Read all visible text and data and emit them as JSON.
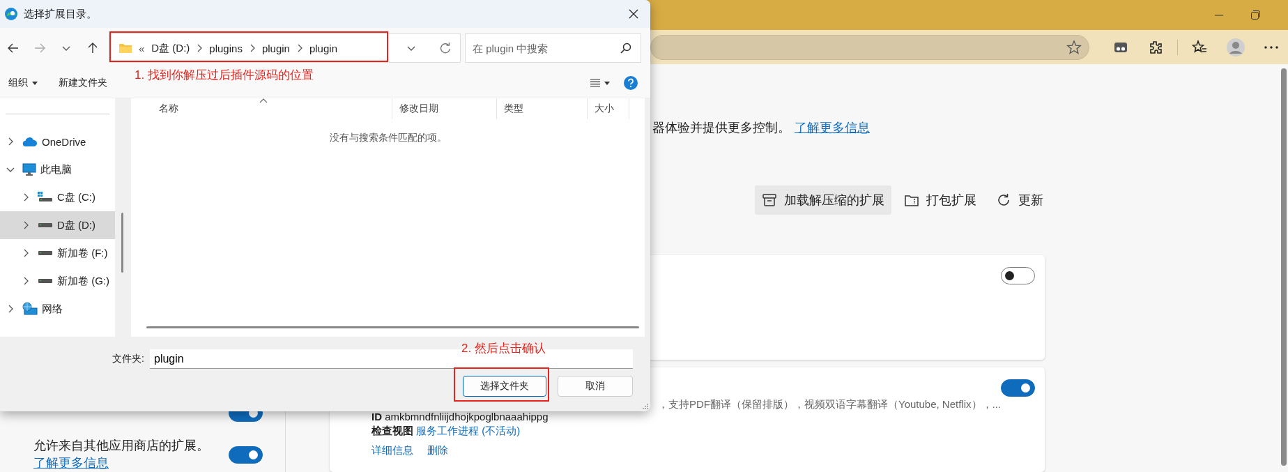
{
  "page": {
    "intro_text": "器体验并提供更多控制。",
    "intro_link": "了解更多信息",
    "actions": [
      {
        "kind": "load",
        "label": "加载解压缩的扩展",
        "selected": true
      },
      {
        "kind": "pack",
        "label": "打包扩展",
        "selected": false
      },
      {
        "kind": "update",
        "label": "更新",
        "selected": false
      }
    ],
    "sidebar": [
      {
        "on": true
      },
      {
        "label": "允许来自其他应用商店的扩展。",
        "link": "了解更多信息",
        "on": true
      }
    ],
    "extensions": [
      {
        "on": false
      },
      {
        "description": "，支持PDF翻译（保留排版），视频双语字幕翻译（Youtube, Netflix），...",
        "id_label": "ID",
        "id": "amkbmndfnliijdhojkpoglbnaaahippg",
        "inspect_label": "检查视图",
        "inspect_link": "服务工作进程 (不活动)",
        "links": [
          "详细信息",
          "删除"
        ],
        "on": true
      }
    ]
  },
  "dialog": {
    "title": "选择扩展目录。",
    "overflow": "«",
    "path": [
      "D盘 (D:)",
      "plugins",
      "plugin",
      "plugin"
    ],
    "search": {
      "placeholder": "在 plugin 中搜索"
    },
    "toolbar": [
      {
        "kind": "menu",
        "label": "组织"
      },
      {
        "kind": "button",
        "label": "新建文件夹"
      }
    ],
    "columns": [
      "名称",
      "修改日期",
      "类型",
      "大小"
    ],
    "empty_message": "没有与搜索条件匹配的项。",
    "nav": [
      {
        "kind": "cloud",
        "label": "OneDrive",
        "expanded": false,
        "selected": false
      },
      {
        "kind": "pc",
        "label": "此电脑",
        "expanded": true,
        "selected": false,
        "children": [
          {
            "kind": "system-drive",
            "label": "C盘 (C:)",
            "expanded": false,
            "selected": false
          },
          {
            "kind": "drive",
            "label": "D盘 (D:)",
            "expanded": false,
            "selected": true
          },
          {
            "kind": "drive",
            "label": "新加卷 (F:)",
            "expanded": false,
            "selected": false
          },
          {
            "kind": "drive",
            "label": "新加卷 (G:)",
            "expanded": false,
            "selected": false
          }
        ]
      },
      {
        "kind": "network",
        "label": "网络",
        "expanded": false,
        "selected": false
      }
    ],
    "folder": {
      "label": "文件夹:",
      "value": "plugin"
    },
    "buttons": [
      {
        "kind": "primary",
        "label": "选择文件夹"
      },
      {
        "kind": "secondary",
        "label": "取消"
      }
    ]
  },
  "annotations": [
    {
      "text": "1. 找到你解压过后插件源码的位置"
    },
    {
      "text": "2. 然后点击确认"
    }
  ]
}
